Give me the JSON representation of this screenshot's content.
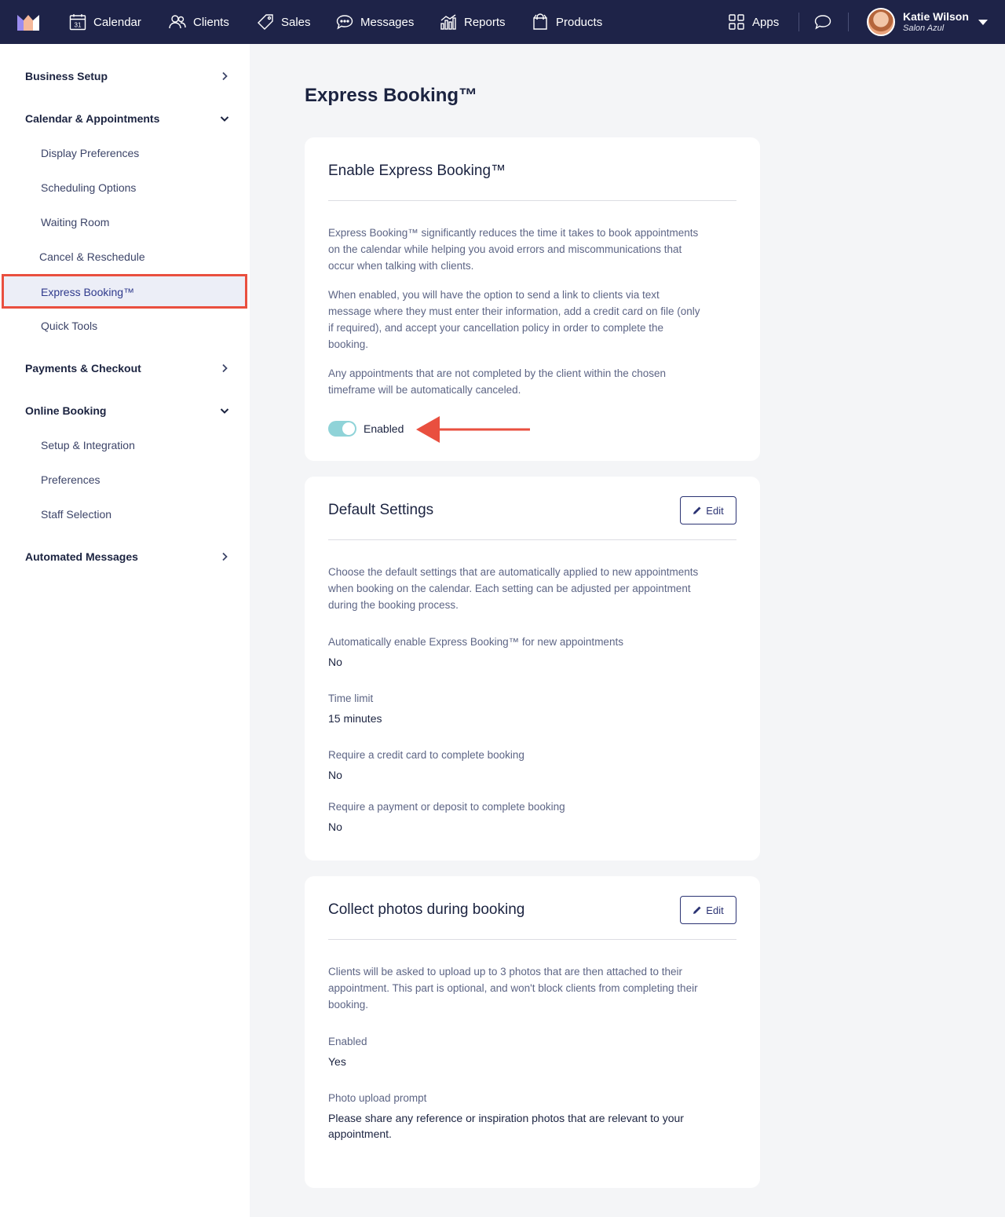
{
  "nav": {
    "items": [
      {
        "label": "Calendar",
        "icon": "calendar-icon"
      },
      {
        "label": "Clients",
        "icon": "clients-icon"
      },
      {
        "label": "Sales",
        "icon": "tag-icon"
      },
      {
        "label": "Messages",
        "icon": "chat-icon"
      },
      {
        "label": "Reports",
        "icon": "bar-chart-icon"
      },
      {
        "label": "Products",
        "icon": "shopping-bag-icon"
      }
    ],
    "apps_label": "Apps",
    "calendar_day": "31",
    "user": {
      "name": "Katie Wilson",
      "org": "Salon Azul"
    }
  },
  "sidebar": {
    "sections": [
      {
        "label": "Business Setup",
        "state": "collapsed"
      },
      {
        "label": "Calendar & Appointments",
        "state": "expanded"
      },
      {
        "label": "Payments & Checkout",
        "state": "collapsed"
      },
      {
        "label": "Online Booking",
        "state": "expanded"
      },
      {
        "label": "Automated Messages",
        "state": "collapsed"
      }
    ],
    "calendar_items": [
      "Display Preferences",
      "Scheduling Options",
      "Waiting Room",
      "Cancel & Reschedule",
      "Express Booking™",
      "Quick Tools"
    ],
    "online_items": [
      "Setup & Integration",
      "Preferences",
      "Staff Selection"
    ],
    "highlight_color": "#e94f3f"
  },
  "page": {
    "title": "Express Booking™"
  },
  "enable_card": {
    "title": "Enable Express Booking™",
    "paragraphs": [
      "Express Booking™ significantly reduces the time it takes to book appointments on the calendar while helping you avoid errors and miscommunications that occur when talking with clients.",
      "When enabled, you will have the option to send a link to clients via text message where they must enter their information, add a credit card on file (only if required), and accept your cancellation policy in order to complete the booking.",
      "Any appointments that are not completed by the client within the chosen timeframe will be automatically canceled."
    ],
    "toggle_label": "Enabled",
    "toggle_on": true
  },
  "default_card": {
    "title": "Default Settings",
    "edit_label": "Edit",
    "description": "Choose the default settings that are automatically applied to new appointments when booking on the calendar. Each setting can be adjusted per appointment during the booking process.",
    "fields": [
      {
        "label": "Automatically enable Express Booking™ for new appointments",
        "value": "No"
      },
      {
        "label": "Time limit",
        "value": "15 minutes"
      },
      {
        "label": "Require a credit card to complete booking",
        "value": "No"
      },
      {
        "label": "Require a payment or deposit to complete booking",
        "value": "No"
      }
    ]
  },
  "photos_card": {
    "title": "Collect photos during booking",
    "edit_label": "Edit",
    "description": "Clients will be asked to upload up to 3 photos that are then attached to their appointment. This part is optional, and won't block clients from completing their booking.",
    "fields": [
      {
        "label": "Enabled",
        "value": "Yes"
      },
      {
        "label": "Photo upload prompt",
        "value": "Please share any reference or inspiration photos that are relevant to your appointment."
      }
    ]
  }
}
